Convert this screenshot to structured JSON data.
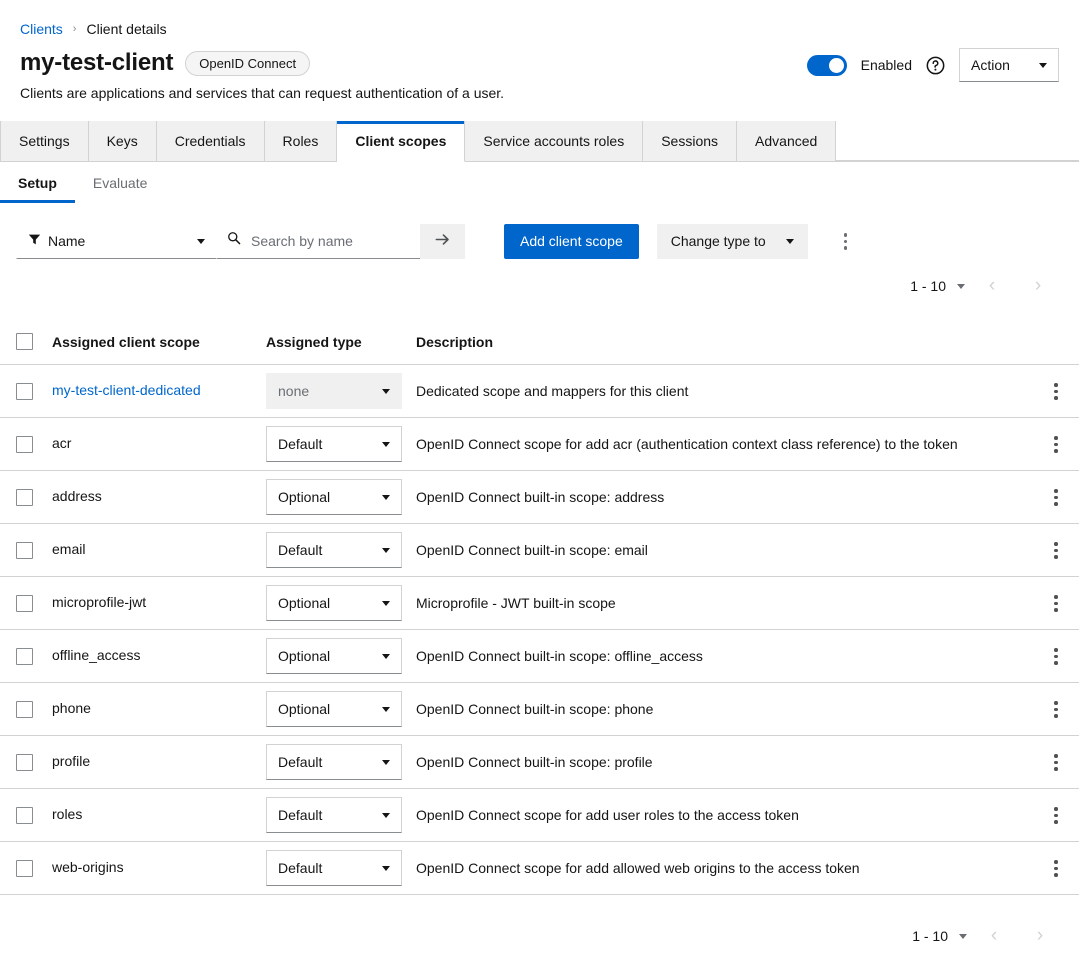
{
  "breadcrumb": {
    "parent": "Clients",
    "separator": "›",
    "current": "Client details"
  },
  "header": {
    "title": "my-test-client",
    "protocol_badge": "OpenID Connect",
    "subtitle": "Clients are applications and services that can request authentication of a user.",
    "enabled_label": "Enabled",
    "enabled_state": true,
    "help_icon": "help-circle-icon",
    "action_label": "Action",
    "accent_color": "#0066cc"
  },
  "tabs": [
    {
      "label": "Settings",
      "active": false
    },
    {
      "label": "Keys",
      "active": false
    },
    {
      "label": "Credentials",
      "active": false
    },
    {
      "label": "Roles",
      "active": false
    },
    {
      "label": "Client scopes",
      "active": true
    },
    {
      "label": "Service accounts roles",
      "active": false
    },
    {
      "label": "Sessions",
      "active": false
    },
    {
      "label": "Advanced",
      "active": false
    }
  ],
  "subtabs": [
    {
      "label": "Setup",
      "active": true
    },
    {
      "label": "Evaluate",
      "active": false
    }
  ],
  "toolbar": {
    "filter_label": "Name",
    "filter_icon": "funnel-icon",
    "search_placeholder": "Search by name",
    "search_value": "",
    "search_icon": "search-icon",
    "search_submit_icon": "arrow-right-icon",
    "add_scope_label": "Add client scope",
    "change_type_label": "Change type to",
    "kebab_icon": "kebab-vertical-icon"
  },
  "pagination": {
    "range": "1 - 10",
    "prev_icon": "chevron-left-icon",
    "next_icon": "chevron-right-icon"
  },
  "table": {
    "columns": [
      "Assigned client scope",
      "Assigned type",
      "Description"
    ],
    "rows": [
      {
        "name": "my-test-client-dedicated",
        "is_link": true,
        "type": "none",
        "type_disabled": true,
        "description": "Dedicated scope and mappers for this client"
      },
      {
        "name": "acr",
        "is_link": false,
        "type": "Default",
        "type_disabled": false,
        "description": "OpenID Connect scope for add acr (authentication context class reference) to the token"
      },
      {
        "name": "address",
        "is_link": false,
        "type": "Optional",
        "type_disabled": false,
        "description": "OpenID Connect built-in scope: address"
      },
      {
        "name": "email",
        "is_link": false,
        "type": "Default",
        "type_disabled": false,
        "description": "OpenID Connect built-in scope: email"
      },
      {
        "name": "microprofile-jwt",
        "is_link": false,
        "type": "Optional",
        "type_disabled": false,
        "description": "Microprofile - JWT built-in scope"
      },
      {
        "name": "offline_access",
        "is_link": false,
        "type": "Optional",
        "type_disabled": false,
        "description": "OpenID Connect built-in scope: offline_access"
      },
      {
        "name": "phone",
        "is_link": false,
        "type": "Optional",
        "type_disabled": false,
        "description": "OpenID Connect built-in scope: phone"
      },
      {
        "name": "profile",
        "is_link": false,
        "type": "Default",
        "type_disabled": false,
        "description": "OpenID Connect built-in scope: profile"
      },
      {
        "name": "roles",
        "is_link": false,
        "type": "Default",
        "type_disabled": false,
        "description": "OpenID Connect scope for add user roles to the access token"
      },
      {
        "name": "web-origins",
        "is_link": false,
        "type": "Default",
        "type_disabled": false,
        "description": "OpenID Connect scope for add allowed web origins to the access token"
      }
    ]
  }
}
